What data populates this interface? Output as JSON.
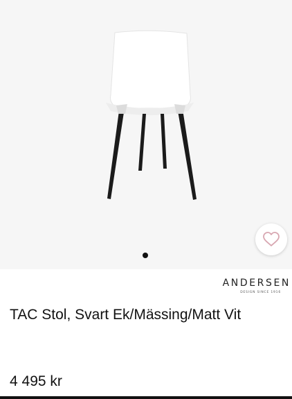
{
  "brand": {
    "name": "ANDERSEN",
    "tagline": "DESIGN SINCE 1916"
  },
  "product": {
    "title": "TAC Stol, Svart Ek/Mässing/Matt Vit",
    "price": "4 495 kr"
  },
  "gallery": {
    "image_count": 1,
    "active_index": 1,
    "favorite_icon": "heart-outline-icon"
  },
  "colors": {
    "accent": "#d8a7b1",
    "background": "#f6f6f6",
    "text": "#111111"
  }
}
